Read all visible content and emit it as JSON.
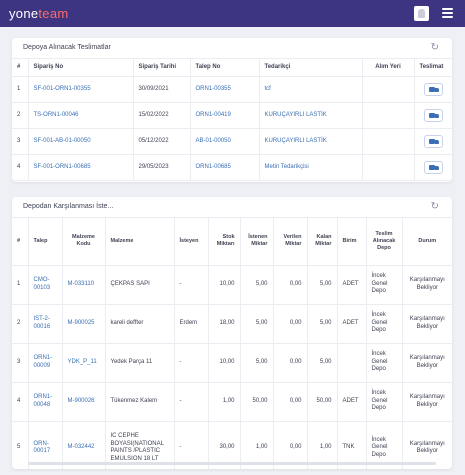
{
  "app": {
    "logo_main": "yone",
    "logo_accent": "team"
  },
  "panel1": {
    "title": "Depoya Alınacak Teslimatlar",
    "columns": [
      "#",
      "Sipariş No",
      "Sipariş Tarihi",
      "Talep No",
      "Tedarikçi",
      "Alım Yeri",
      "Teslimat"
    ],
    "rows": [
      [
        "1",
        "SF-001-ORN1-00355",
        "30/09/2021",
        "ORN1-00355",
        "tcf",
        ""
      ],
      [
        "2",
        "TS-ORN1-00046",
        "15/02/2022",
        "ORN1-00419",
        "KURUÇAYIRLI LASTİK",
        ""
      ],
      [
        "3",
        "SF-001-AB-01-00050",
        "05/12/2022",
        "AB-01-00050",
        "KURUÇAYIRLI LASTİK",
        ""
      ],
      [
        "4",
        "SF-001-ORN1-00685",
        "29/05/2023",
        "ORN1-00685",
        "Metin Tedarikçisi",
        ""
      ]
    ]
  },
  "panel2": {
    "title": "Depodan Karşılanması İste...",
    "columns": [
      "#",
      "Talep",
      "Malzeme Kodu",
      "Malzeme",
      "İsteyen",
      "Stok Miktarı",
      "İstenen Miktar",
      "Verilen Miktar",
      "Kalan Miktar",
      "Birim",
      "Teslim Alınacak Depo",
      "Durum"
    ],
    "rows": [
      [
        "1",
        "CMO-00103",
        "M-033110",
        "ÇEKPAS SAPI",
        "-",
        "10,00",
        "5,00",
        "0,00",
        "5,00",
        "ADET",
        "İncek Genel Depo",
        "Karşılanmayı Bekliyor"
      ],
      [
        "2",
        "IST-2-00016",
        "M-900025",
        "kareli deffter",
        "Erdem",
        "18,00",
        "5,00",
        "0,00",
        "5,00",
        "ADET",
        "İncek Genel Depo",
        "Karşılanmayı Bekliyor"
      ],
      [
        "3",
        "ORN1-00009",
        "YDK_P_11",
        "Yedek Parça 11",
        "-",
        "10,00",
        "5,00",
        "0,00",
        "5,00",
        "",
        "İncek Genel Depo",
        "Karşılanmayı Bekliyor"
      ],
      [
        "4",
        "ORN1-00048",
        "M-900026",
        "Tükenmez Kalem",
        "-",
        "1,00",
        "50,00",
        "0,00",
        "50,00",
        "ADET",
        "İncek Genel Depo",
        "Karşılanmayı Bekliyor"
      ],
      [
        "5",
        "ORN-00017",
        "M-032442",
        "IC CEPHE BOYASI(NATIONAL PAINTS /PLASTIC EMULSION 18 LT",
        "-",
        "30,00",
        "1,00",
        "0,00",
        "1,00",
        "TNK",
        "İncek Genel Depo",
        "Karşılanmayı Bekliyor"
      ]
    ]
  },
  "colors": {
    "topbar": "#3d3582",
    "link": "#3a6fb5",
    "logo_accent": "#ff6b6b"
  },
  "icons": {
    "refresh": "refresh-icon",
    "delivery": "truck-icon",
    "menu": "hamburger-icon",
    "user": "user-icon"
  }
}
